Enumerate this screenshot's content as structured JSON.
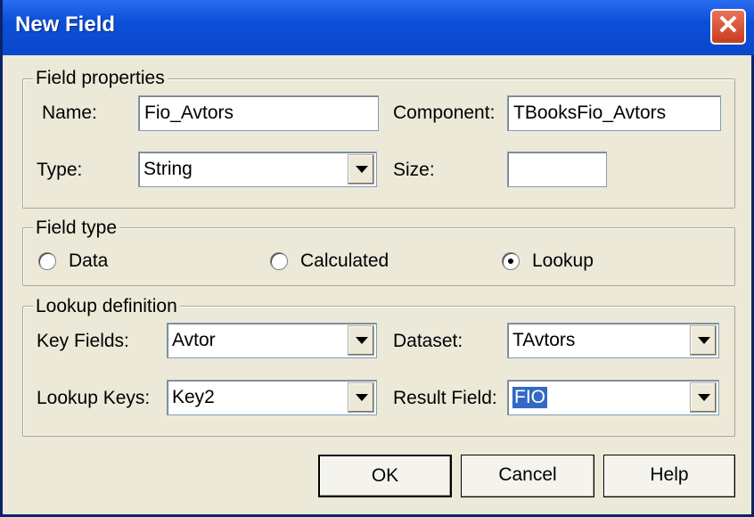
{
  "window": {
    "title": "New Field",
    "close_label": "✕"
  },
  "field_properties": {
    "legend": "Field properties",
    "name_label": "Name:",
    "name_value": "Fio_Avtors",
    "component_label": "Component:",
    "component_value": "TBooksFio_Avtors",
    "type_label": "Type:",
    "type_value": "String",
    "size_label": "Size:",
    "size_value": ""
  },
  "field_type": {
    "legend": "Field type",
    "options": [
      {
        "label": "Data",
        "checked": false
      },
      {
        "label": "Calculated",
        "checked": false
      },
      {
        "label": "Lookup",
        "checked": true
      }
    ]
  },
  "lookup_definition": {
    "legend": "Lookup definition",
    "key_fields_label": "Key Fields:",
    "key_fields_value": "Avtor",
    "dataset_label": "Dataset:",
    "dataset_value": "TAvtors",
    "lookup_keys_label": "Lookup Keys:",
    "lookup_keys_value": "Key2",
    "result_field_label": "Result Field:",
    "result_field_value": "FIO"
  },
  "buttons": {
    "ok": "OK",
    "cancel": "Cancel",
    "help": "Help"
  },
  "icons": {
    "close": "close-icon",
    "dropdown": "chevron-down-icon"
  }
}
